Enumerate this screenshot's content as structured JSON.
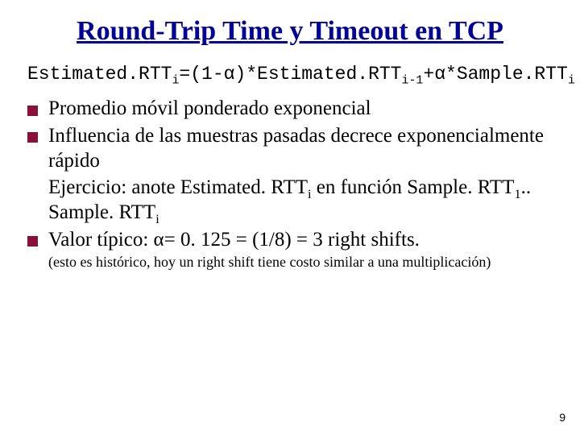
{
  "title": "Round-Trip Time y Timeout en TCP",
  "formula": {
    "lhs_base": "Estimated.RTT",
    "lhs_sub": "i",
    "eq": "=(1-",
    "alpha1": "α",
    "mid1": ")*Estimated.RTT",
    "mid1_sub": "i-1",
    "plus": "+",
    "alpha2": "α",
    "tail": "*Sample.RTT",
    "tail_sub": "i"
  },
  "bullets": {
    "b1": "Promedio móvil ponderado exponencial",
    "b2": "Influencia de las muestras pasadas decrece exponencialmente rápido",
    "ex_label": "Ejercicio: anote Estimated. RTT",
    "ex_sub1": "i",
    "ex_mid": " en función Sample. RTT",
    "ex_sub2": "1",
    "ex_mid2": ".. Sample. RTT",
    "ex_sub3": "i",
    "b3_a": "Valor típico: ",
    "b3_alpha": "α",
    "b3_b": "= 0. 125 = (1/8) = 3 right shifts."
  },
  "note": "(esto es histórico, hoy un right shift tiene costo similar a una multiplicación)",
  "page": "9"
}
